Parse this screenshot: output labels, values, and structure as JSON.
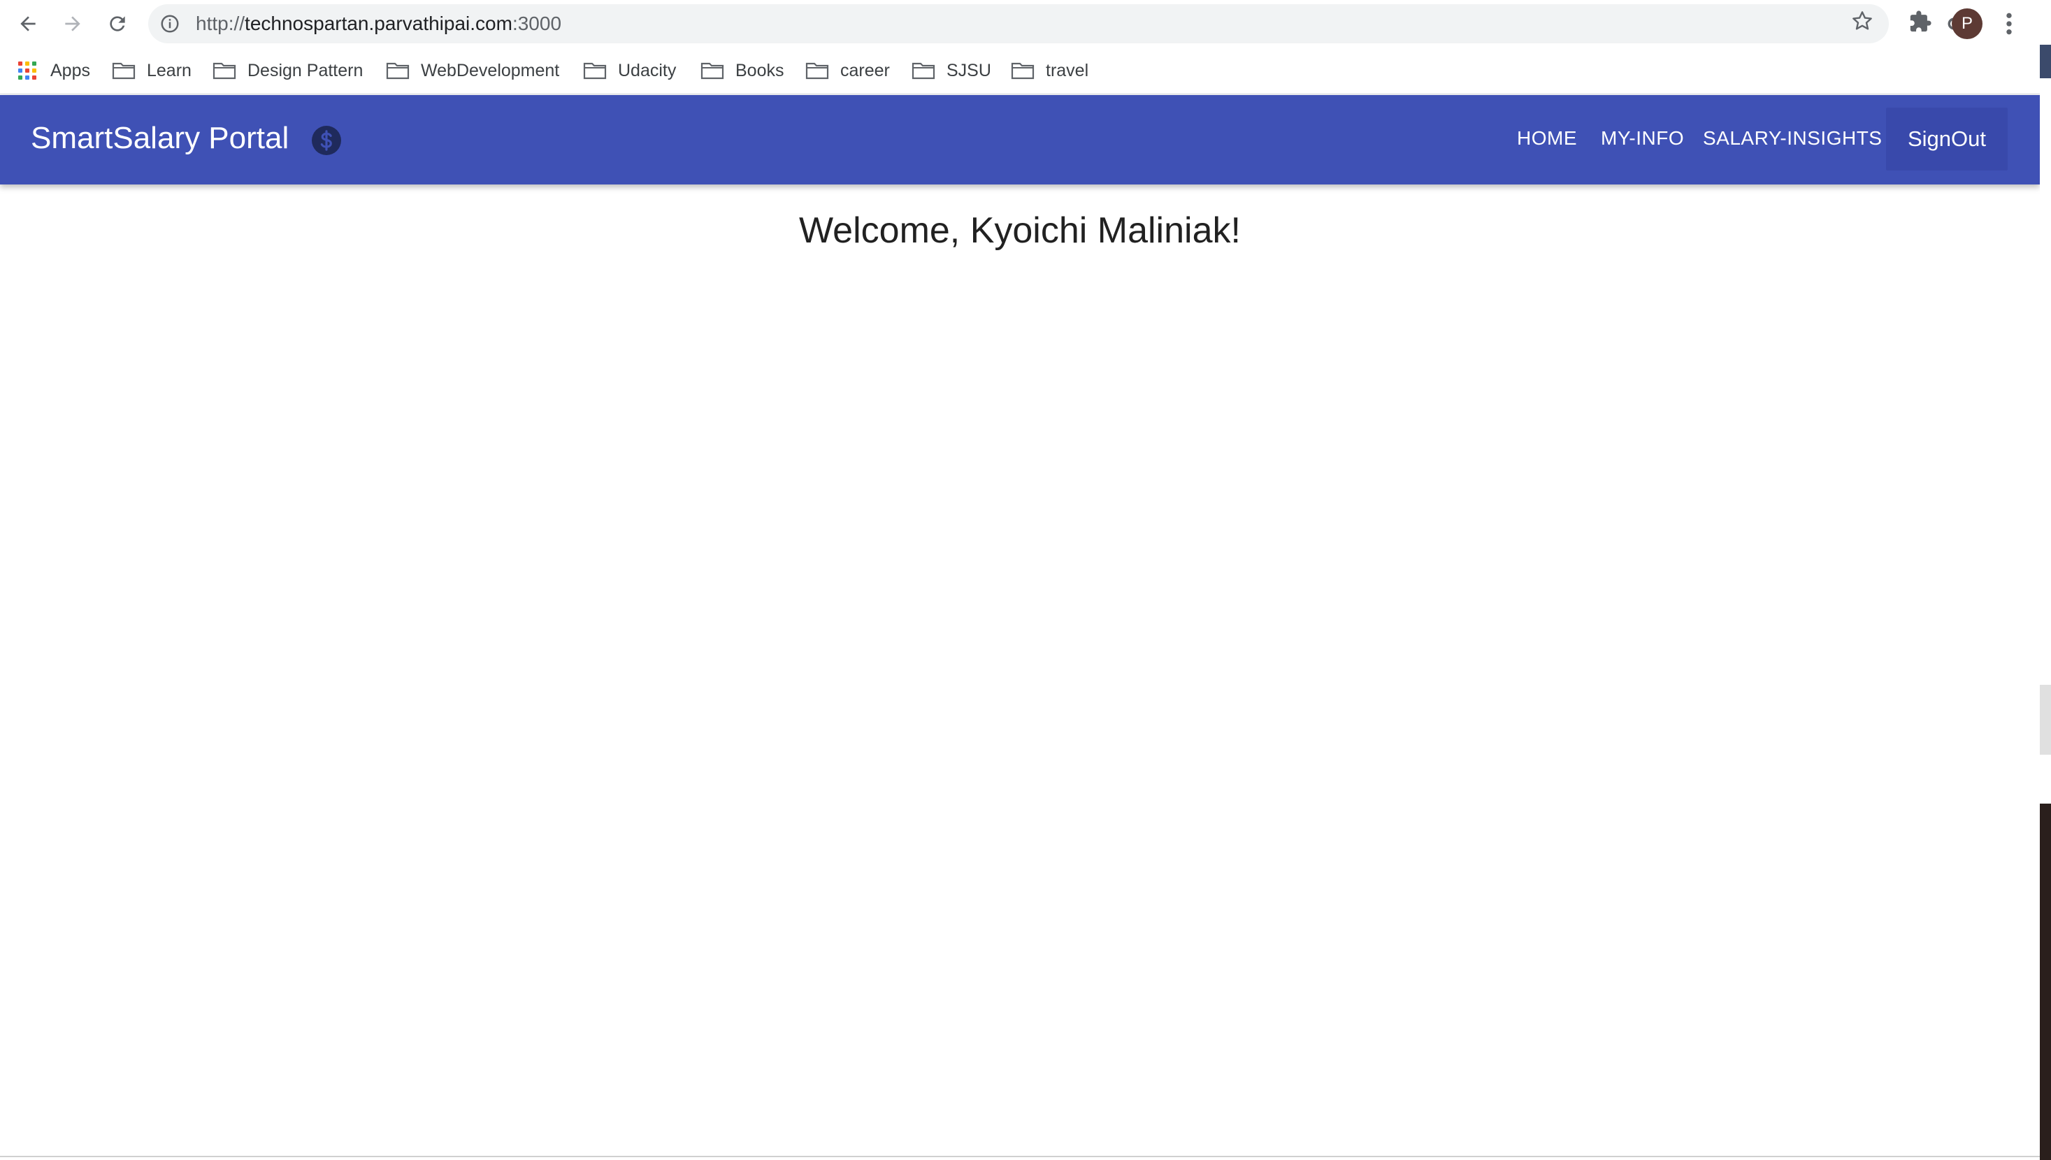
{
  "browser": {
    "url_scheme": "http://",
    "url_host": "technospartan.parvathipai.com",
    "url_port": ":3000",
    "profile_initial": "P",
    "icons": [
      "back-icon",
      "forward-icon",
      "reload-icon",
      "info-icon",
      "key-icon",
      "star-icon",
      "extensions-icon",
      "menu-icon"
    ]
  },
  "bookmarks": {
    "apps_label": "Apps",
    "items": [
      "Learn",
      "Design Pattern",
      "WebDevelopment",
      "Udacity",
      "Books",
      "career",
      "SJSU",
      "travel"
    ]
  },
  "header": {
    "brand": "SmartSalary Portal",
    "brand_icon": "dollar-icon",
    "nav": [
      "HOME",
      "MY-INFO",
      "SALARY-INSIGHTS"
    ],
    "signout": "SignOut",
    "colors": {
      "bar": "#3f51b5",
      "button": "#3949ab"
    }
  },
  "main": {
    "welcome": "Welcome, Kyoichi Maliniak!"
  }
}
